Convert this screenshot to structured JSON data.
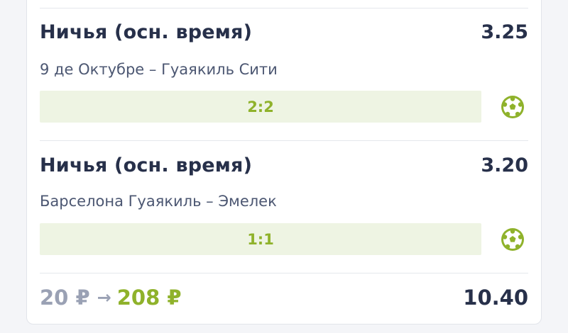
{
  "colors": {
    "accent_green": "#8fb22b",
    "score_bg": "#eef4e3",
    "text_dark": "#27304a",
    "text_muted": "#9aa1b4"
  },
  "bets": [
    {
      "market": "Ничья (осн. время)",
      "odds": "3.25",
      "match": "9 де Октубре – Гуаякиль Сити",
      "score": "2:2",
      "sport_icon": "soccer-ball-icon"
    },
    {
      "market": "Ничья (осн. время)",
      "odds": "3.20",
      "match": "Барселона Гуаякиль – Эмелек",
      "score": "1:1",
      "sport_icon": "soccer-ball-icon"
    }
  ],
  "summary": {
    "stake": "20 ₽",
    "arrow": "→",
    "payout": "208 ₽",
    "total_odds": "10.40"
  }
}
